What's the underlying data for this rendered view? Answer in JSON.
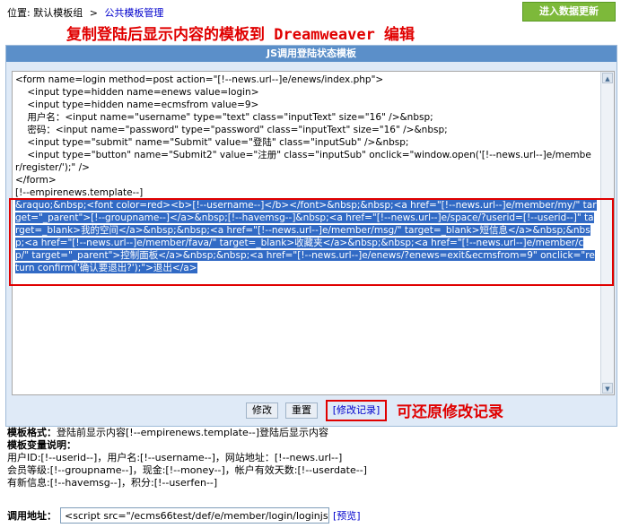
{
  "breadcrumb": {
    "location_label": "位置:",
    "group": "默认模板组",
    "separator": ">",
    "current": "公共模板管理"
  },
  "enter_data_button": "进入数据更新",
  "annotation_top": "复制登陆后显示内容的模板到 Dreamweaver 编辑",
  "panel": {
    "title": "JS调用登陆状态模板",
    "code_before": "<form name=login method=post action=\"[!--news.url--]e/enews/index.php\">\n    <input type=hidden name=enews value=login>\n    <input type=hidden name=ecmsfrom value=9>\n    用户名：<input name=\"username\" type=\"text\" class=\"inputText\" size=\"16\" />&nbsp;\n    密码：<input name=\"password\" type=\"password\" class=\"inputText\" size=\"16\" />&nbsp;\n    <input type=\"submit\" name=\"Submit\" value=\"登陆\" class=\"inputSub\" />&nbsp;\n    <input type=\"button\" name=\"Submit2\" value=\"注册\" class=\"inputSub\" onclick=\"window.open('[!--news.url--]e/member/register/');\" />\n</form>\n[!--empirenews.template--]",
    "code_selected": "&raquo;&nbsp;<font color=red><b>[!--username--]</b></font>&nbsp;&nbsp;<a href=\"[!--news.url--]e/member/my/\" target=\"_parent\">[!--groupname--]</a>&nbsp;[!--havemsg--]&nbsp;<a href=\"[!--news.url--]e/space/?userid=[!--userid--]\" target=_blank>我的空间</a>&nbsp;&nbsp;<a href=\"[!--news.url--]e/member/msg/\" target=_blank>短信息</a>&nbsp;&nbsp;<a href=\"[!--news.url--]e/member/fava/\" target=_blank>收藏夹</a>&nbsp;&nbsp;<a href=\"[!--news.url--]e/member/cp/\" target=\"_parent\">控制面板</a>&nbsp;&nbsp;<a href=\"[!--news.url--]e/enews/?enews=exit&ecmsfrom=9\" onclick=\"return confirm('确认要退出?');\">退出</a>"
  },
  "buttons": {
    "modify": "修改",
    "reset": "重置",
    "modify_log": "[修改记录]"
  },
  "annotation_right": "可还原修改记录",
  "info": {
    "format_label": "模板格式：",
    "format_value": "登陆前显示内容[!--empirenews.template--]登陆后显示内容",
    "vars_label": "模板变量说明：",
    "vars_line1": "用户ID:[!--userid--]，用户名:[!--username--]，网站地址：[!--news.url--]",
    "vars_line2": "会员等级:[!--groupname--]，现金:[!--money--]，帐户有效天数:[!--userdate--]",
    "vars_line3": "有新信息:[!--havemsg--]，积分:[!--userfen--]"
  },
  "call": {
    "label": "调用地址：",
    "value": "<script src=\"/ecms66test/def/e/member/login/loginjs.php",
    "preview": "[预览]"
  },
  "colors": {
    "annotation_red": "#e00000",
    "panel_header": "#5b8fc9",
    "selection": "#316ac5",
    "enter_button": "#7db93a"
  }
}
